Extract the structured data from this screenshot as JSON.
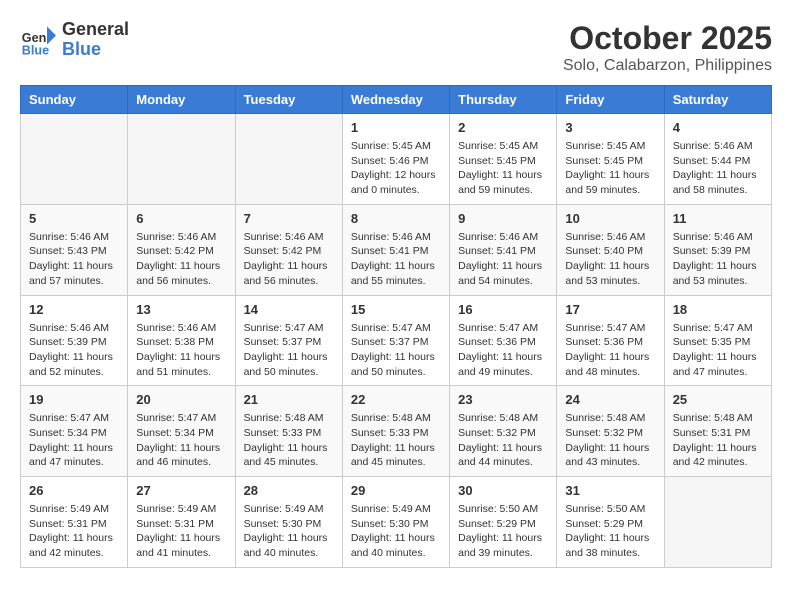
{
  "logo": {
    "line1": "General",
    "line2": "Blue"
  },
  "title": "October 2025",
  "subtitle": "Solo, Calabarzon, Philippines",
  "weekdays": [
    "Sunday",
    "Monday",
    "Tuesday",
    "Wednesday",
    "Thursday",
    "Friday",
    "Saturday"
  ],
  "weeks": [
    [
      {
        "day": "",
        "info": ""
      },
      {
        "day": "",
        "info": ""
      },
      {
        "day": "",
        "info": ""
      },
      {
        "day": "1",
        "info": "Sunrise: 5:45 AM\nSunset: 5:46 PM\nDaylight: 12 hours\nand 0 minutes."
      },
      {
        "day": "2",
        "info": "Sunrise: 5:45 AM\nSunset: 5:45 PM\nDaylight: 11 hours\nand 59 minutes."
      },
      {
        "day": "3",
        "info": "Sunrise: 5:45 AM\nSunset: 5:45 PM\nDaylight: 11 hours\nand 59 minutes."
      },
      {
        "day": "4",
        "info": "Sunrise: 5:46 AM\nSunset: 5:44 PM\nDaylight: 11 hours\nand 58 minutes."
      }
    ],
    [
      {
        "day": "5",
        "info": "Sunrise: 5:46 AM\nSunset: 5:43 PM\nDaylight: 11 hours\nand 57 minutes."
      },
      {
        "day": "6",
        "info": "Sunrise: 5:46 AM\nSunset: 5:42 PM\nDaylight: 11 hours\nand 56 minutes."
      },
      {
        "day": "7",
        "info": "Sunrise: 5:46 AM\nSunset: 5:42 PM\nDaylight: 11 hours\nand 56 minutes."
      },
      {
        "day": "8",
        "info": "Sunrise: 5:46 AM\nSunset: 5:41 PM\nDaylight: 11 hours\nand 55 minutes."
      },
      {
        "day": "9",
        "info": "Sunrise: 5:46 AM\nSunset: 5:41 PM\nDaylight: 11 hours\nand 54 minutes."
      },
      {
        "day": "10",
        "info": "Sunrise: 5:46 AM\nSunset: 5:40 PM\nDaylight: 11 hours\nand 53 minutes."
      },
      {
        "day": "11",
        "info": "Sunrise: 5:46 AM\nSunset: 5:39 PM\nDaylight: 11 hours\nand 53 minutes."
      }
    ],
    [
      {
        "day": "12",
        "info": "Sunrise: 5:46 AM\nSunset: 5:39 PM\nDaylight: 11 hours\nand 52 minutes."
      },
      {
        "day": "13",
        "info": "Sunrise: 5:46 AM\nSunset: 5:38 PM\nDaylight: 11 hours\nand 51 minutes."
      },
      {
        "day": "14",
        "info": "Sunrise: 5:47 AM\nSunset: 5:37 PM\nDaylight: 11 hours\nand 50 minutes."
      },
      {
        "day": "15",
        "info": "Sunrise: 5:47 AM\nSunset: 5:37 PM\nDaylight: 11 hours\nand 50 minutes."
      },
      {
        "day": "16",
        "info": "Sunrise: 5:47 AM\nSunset: 5:36 PM\nDaylight: 11 hours\nand 49 minutes."
      },
      {
        "day": "17",
        "info": "Sunrise: 5:47 AM\nSunset: 5:36 PM\nDaylight: 11 hours\nand 48 minutes."
      },
      {
        "day": "18",
        "info": "Sunrise: 5:47 AM\nSunset: 5:35 PM\nDaylight: 11 hours\nand 47 minutes."
      }
    ],
    [
      {
        "day": "19",
        "info": "Sunrise: 5:47 AM\nSunset: 5:34 PM\nDaylight: 11 hours\nand 47 minutes."
      },
      {
        "day": "20",
        "info": "Sunrise: 5:47 AM\nSunset: 5:34 PM\nDaylight: 11 hours\nand 46 minutes."
      },
      {
        "day": "21",
        "info": "Sunrise: 5:48 AM\nSunset: 5:33 PM\nDaylight: 11 hours\nand 45 minutes."
      },
      {
        "day": "22",
        "info": "Sunrise: 5:48 AM\nSunset: 5:33 PM\nDaylight: 11 hours\nand 45 minutes."
      },
      {
        "day": "23",
        "info": "Sunrise: 5:48 AM\nSunset: 5:32 PM\nDaylight: 11 hours\nand 44 minutes."
      },
      {
        "day": "24",
        "info": "Sunrise: 5:48 AM\nSunset: 5:32 PM\nDaylight: 11 hours\nand 43 minutes."
      },
      {
        "day": "25",
        "info": "Sunrise: 5:48 AM\nSunset: 5:31 PM\nDaylight: 11 hours\nand 42 minutes."
      }
    ],
    [
      {
        "day": "26",
        "info": "Sunrise: 5:49 AM\nSunset: 5:31 PM\nDaylight: 11 hours\nand 42 minutes."
      },
      {
        "day": "27",
        "info": "Sunrise: 5:49 AM\nSunset: 5:31 PM\nDaylight: 11 hours\nand 41 minutes."
      },
      {
        "day": "28",
        "info": "Sunrise: 5:49 AM\nSunset: 5:30 PM\nDaylight: 11 hours\nand 40 minutes."
      },
      {
        "day": "29",
        "info": "Sunrise: 5:49 AM\nSunset: 5:30 PM\nDaylight: 11 hours\nand 40 minutes."
      },
      {
        "day": "30",
        "info": "Sunrise: 5:50 AM\nSunset: 5:29 PM\nDaylight: 11 hours\nand 39 minutes."
      },
      {
        "day": "31",
        "info": "Sunrise: 5:50 AM\nSunset: 5:29 PM\nDaylight: 11 hours\nand 38 minutes."
      },
      {
        "day": "",
        "info": ""
      }
    ]
  ]
}
